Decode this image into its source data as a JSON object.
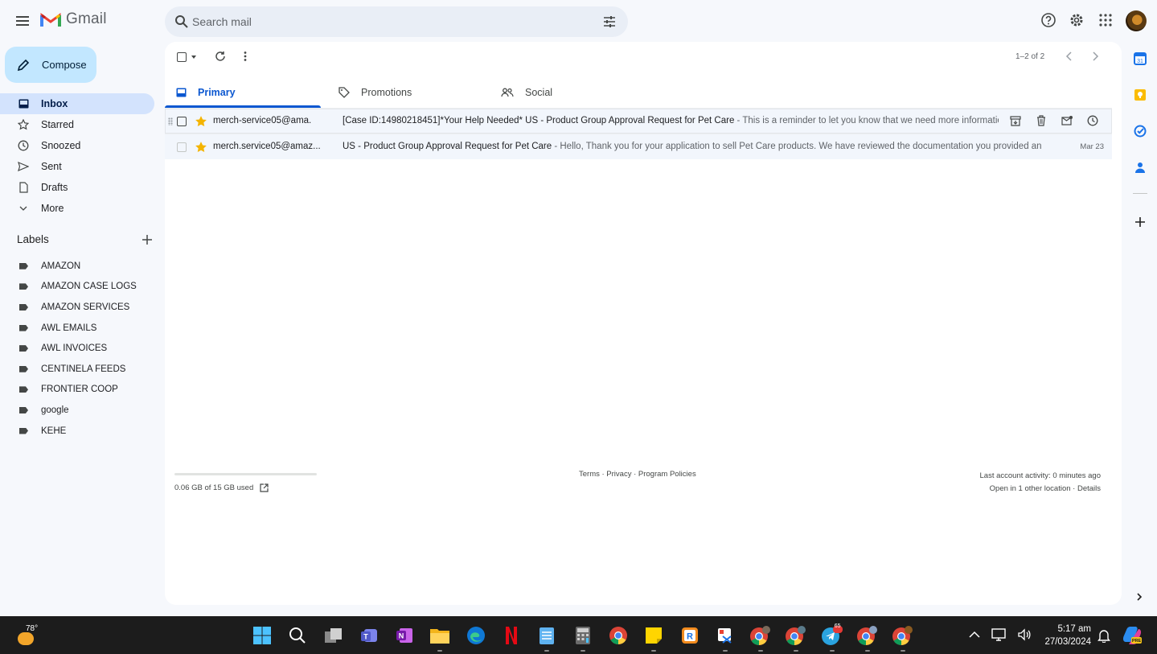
{
  "app": {
    "name": "Gmail",
    "accent": "#0b57d0",
    "compose_color": "#c2e7ff"
  },
  "search": {
    "placeholder": "Search mail"
  },
  "compose": {
    "label": "Compose"
  },
  "nav": {
    "items": [
      {
        "label": "Inbox",
        "icon": "inbox-icon",
        "active": true
      },
      {
        "label": "Starred",
        "icon": "star-icon"
      },
      {
        "label": "Snoozed",
        "icon": "clock-icon"
      },
      {
        "label": "Sent",
        "icon": "send-icon"
      },
      {
        "label": "Drafts",
        "icon": "draft-icon"
      },
      {
        "label": "More",
        "icon": "chevron-down-icon"
      }
    ]
  },
  "labels": {
    "title": "Labels",
    "items": [
      "AMAZON",
      "AMAZON CASE LOGS",
      "AMAZON SERVICES",
      "AWL EMAILS",
      "AWL INVOICES",
      "CENTINELA FEEDS",
      "FRONTIER COOP",
      "google",
      "KEHE"
    ]
  },
  "toolbar": {
    "pager": "1–2 of 2"
  },
  "tabs": [
    {
      "label": "Primary",
      "icon": "inbox-icon",
      "active": true
    },
    {
      "label": "Promotions",
      "icon": "tag-icon"
    },
    {
      "label": "Social",
      "icon": "people-icon"
    }
  ],
  "emails": [
    {
      "sender": "merch-service05@ama.",
      "subject": "[Case ID:14980218451]*Your Help Needed* US - Product Group Approval Request for Pet Care",
      "snippet": " - This is a reminder to let you know that we need more information from you to continue working on your request.",
      "starred": true
    },
    {
      "sender": "merch.service05@amaz...",
      "subject": "US - Product Group Approval Request for Pet Care",
      "snippet": " - Hello, Thank you for your application to sell Pet Care products. We have reviewed the documentation you provided and determined",
      "date": "Mar 23",
      "starred": true
    }
  ],
  "footer": {
    "storage": "0.06 GB of 15 GB used",
    "storage_fraction": 0.004,
    "links": "Terms · Privacy · Program Policies",
    "activity": "Last account activity: 0 minutes ago",
    "location": "Open in 1 other location · Details"
  },
  "taskbar": {
    "temperature": "78°",
    "time": "5:17 am",
    "date": "27/03/2024",
    "telegram_badge": "65"
  }
}
